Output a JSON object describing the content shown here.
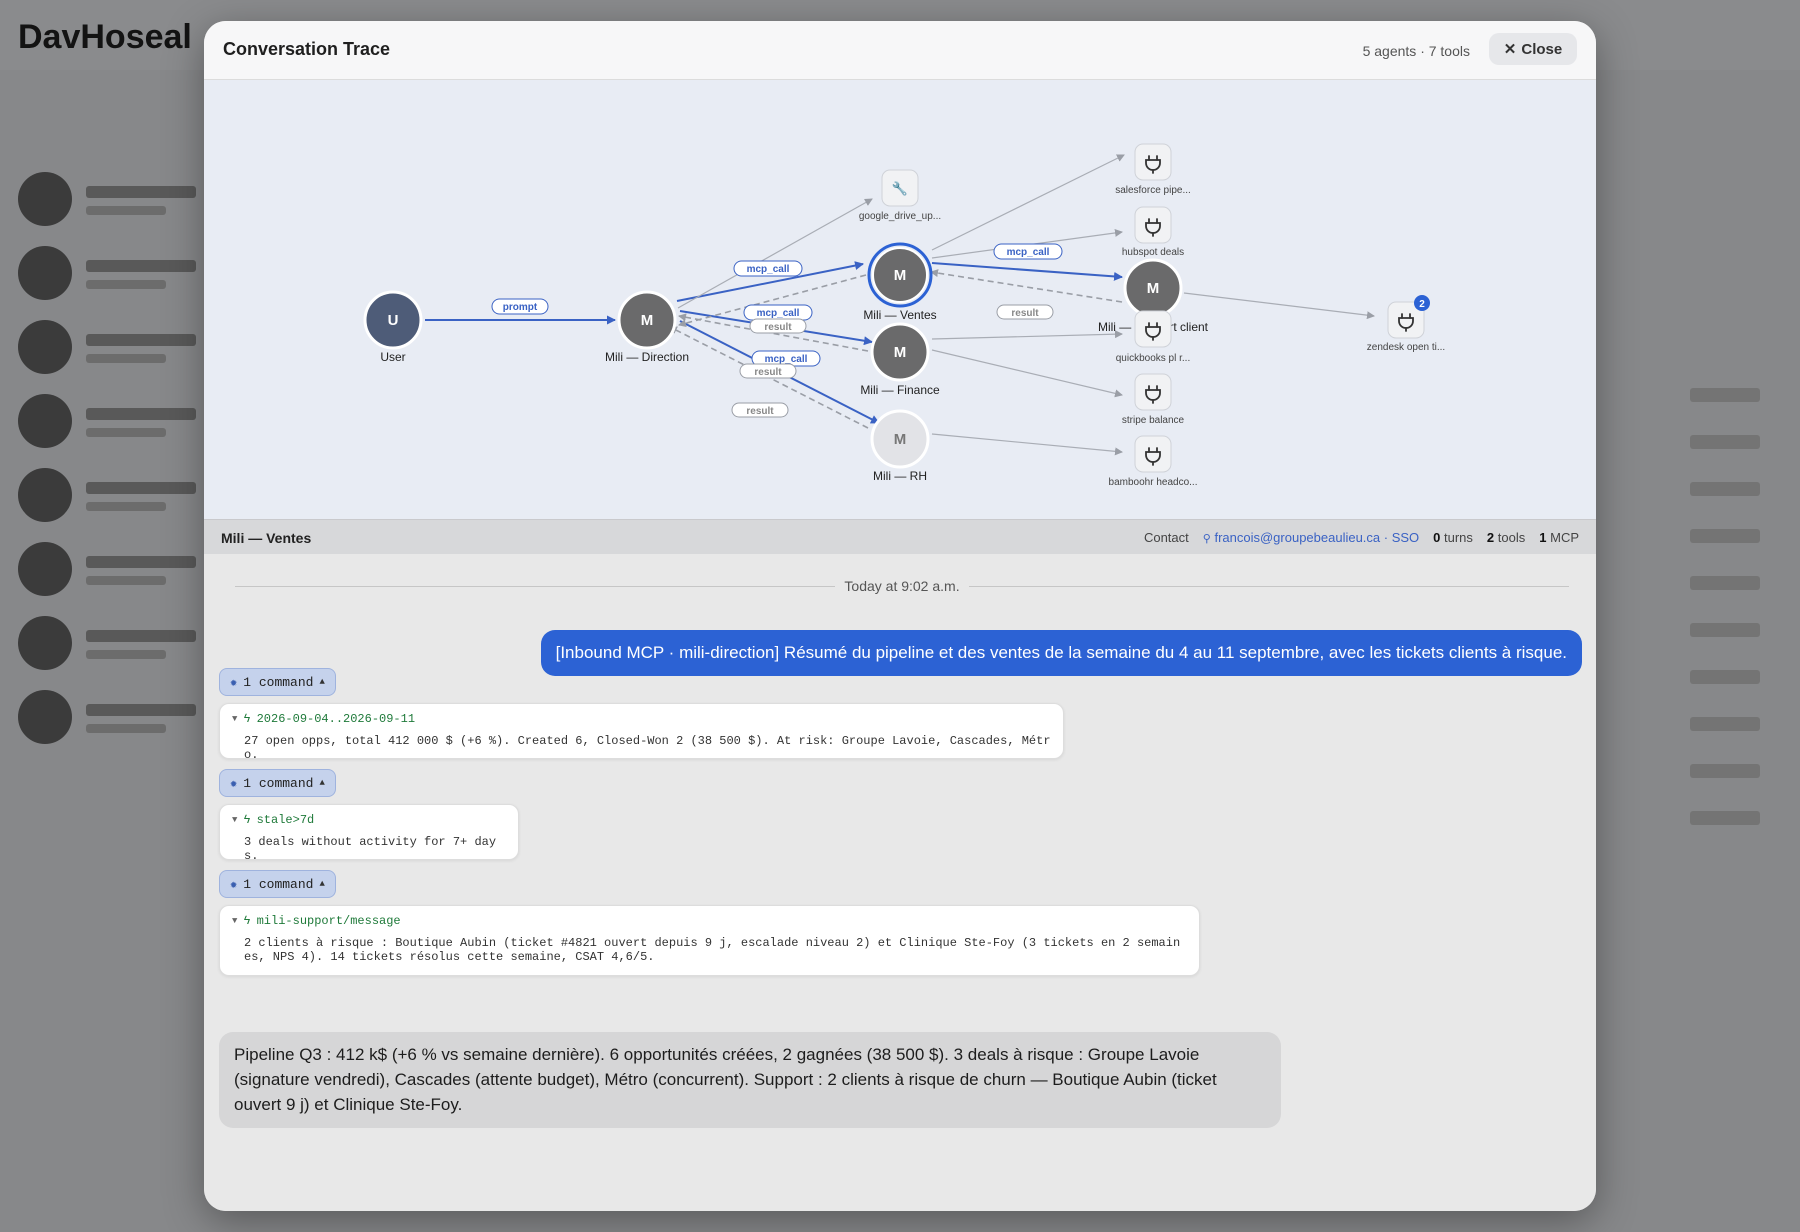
{
  "background": {
    "app_title": "DavHoseal"
  },
  "modal": {
    "title": "Conversation Trace",
    "meta": "5 agents · 7 tools",
    "close_label": "Close"
  },
  "graph": {
    "nodes": {
      "user": {
        "letter": "U",
        "label": "User"
      },
      "direction": {
        "letter": "M",
        "label": "Mili — Direction"
      },
      "ventes": {
        "letter": "M",
        "label": "Mili — Ventes"
      },
      "finance": {
        "letter": "M",
        "label": "Mili — Finance"
      },
      "rh": {
        "letter": "M",
        "label": "Mili — RH"
      },
      "support": {
        "letter": "M",
        "label": "Mili — Support client"
      }
    },
    "tools": {
      "google_drive": "google_drive_up...",
      "salesforce": "salesforce pipe...",
      "hubspot": "hubspot deals",
      "quickbooks": "quickbooks pl r...",
      "stripe": "stripe balance",
      "bamboohr": "bamboohr headco...",
      "zendesk": "zendesk open ti...",
      "zendesk_badge": "2"
    },
    "edges": {
      "prompt": "prompt",
      "mcp_call": "mcp_call",
      "result": "result"
    },
    "colors": {
      "accent": "#3a62c4",
      "gray": "#9a9ea6",
      "selected_ring": "#2c62d4"
    }
  },
  "agent_bar": {
    "name": "Mili — Ventes",
    "contact_label": "Contact",
    "email": "francois@groupebeaulieu.ca · SSO",
    "turns_count": "0",
    "turns_label": "turns",
    "tools_count": "2",
    "tools_label": "tools",
    "mcp_count": "1",
    "mcp_label": "MCP"
  },
  "chat": {
    "date": "Today at 9:02 a.m.",
    "user_message": "[Inbound MCP · mili-direction] Résumé du pipeline et des ventes de la semaine du 4 au 11 septembre, avec les tickets clients à risque.",
    "commands": [
      {
        "pill": "1 command",
        "name": "2026-09-04..2026-09-11",
        "output": "27 open opps, total 412 000 $ (+6 %). Created 6, Closed-Won 2 (38 500 $). At risk: Groupe Lavoie, Cascades, Métro."
      },
      {
        "pill": "1 command",
        "name": "stale>7d",
        "output": "3 deals without activity for 7+ days."
      },
      {
        "pill": "1 command",
        "name": "mili-support/message",
        "output": "2 clients à risque : Boutique Aubin (ticket #4821 ouvert depuis 9 j, escalade niveau 2) et Clinique Ste-Foy (3 tickets en 2 semaines, NPS 4). 14 tickets résolus cette semaine, CSAT 4,6/5."
      }
    ],
    "assistant_message": "Pipeline Q3 : 412 k$ (+6 % vs semaine dernière). 6 opportunités créées, 2 gagnées (38 500 $). 3 deals à risque : Groupe Lavoie (signature vendredi), Cascades (attente budget), Métro (concurrent). Support : 2 clients à risque de churn — Boutique Aubin (ticket ouvert 9 j) et Clinique Ste-Foy."
  }
}
